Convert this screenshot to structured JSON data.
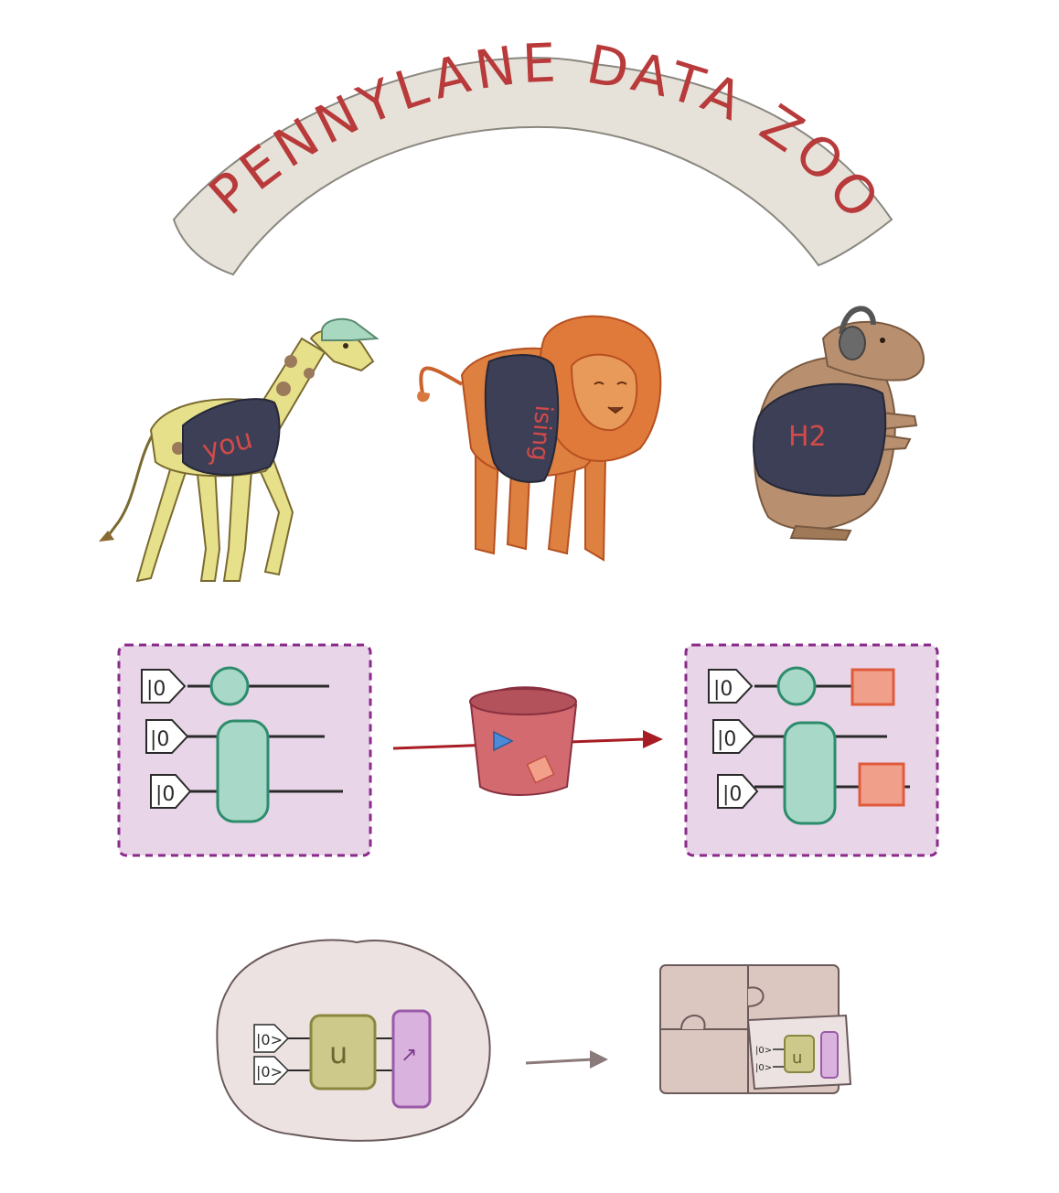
{
  "banner": {
    "title": "PENNYLANE DATA ZOO",
    "text_color": "#b83a3a",
    "fill": "#e6e2da"
  },
  "animals": [
    {
      "kind": "giraffe",
      "shirt_label": "you"
    },
    {
      "kind": "lion",
      "shirt_label": "ising"
    },
    {
      "kind": "capybara",
      "shirt_label": "H2"
    }
  ],
  "circuit_left": {
    "qubits": [
      "|0",
      "|0",
      "|0"
    ]
  },
  "circuit_right": {
    "qubits": [
      "|0",
      "|0",
      "|0"
    ]
  },
  "small_circuit": {
    "qubits": [
      "|0>",
      "|0>"
    ],
    "gate_label": "u",
    "measure_label": "↗"
  },
  "puzzle_circuit": {
    "qubits": [
      "|0>",
      "|0>"
    ],
    "gate_label": "u"
  },
  "colors": {
    "circuit_bg": "#e8d5e8",
    "circuit_border": "#8a2a8a",
    "teal": "#a8d8c8",
    "teal_stroke": "#2d8c6c",
    "measure": "#f0a08a",
    "measure_stroke": "#e05a3c",
    "bucket": "#d36a70",
    "arrow": "#a81c24",
    "navy": "#3c3f55",
    "shirt_text": "#d24a4a",
    "olive": "#ccc98a",
    "purple": "#d9b3de"
  }
}
